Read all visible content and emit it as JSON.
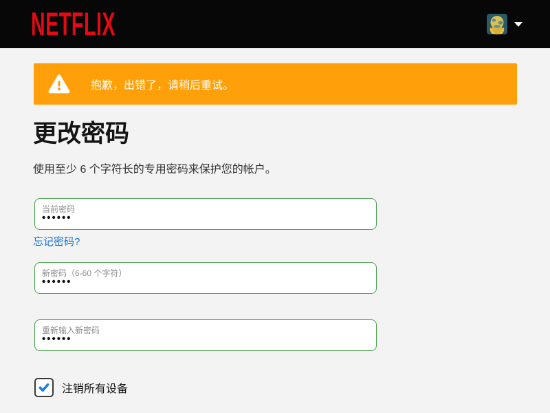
{
  "header": {
    "logo_text": "NETFLIX",
    "avatar_name": "profile-avatar",
    "caret_name": "caret-down"
  },
  "alert": {
    "message": "抱歉，出错了，请稍后重试。",
    "icon": "warning-triangle-icon"
  },
  "page": {
    "title": "更改密码",
    "subtitle": "使用至少 6 个字符长的专用密码来保护您的帐户。"
  },
  "form": {
    "current_password": {
      "label": "当前密码",
      "value_masked": "••••••"
    },
    "forgot_link_label": "忘记密码?",
    "new_password": {
      "label": "新密码（6-60 个字符）",
      "value_masked": "••••••"
    },
    "confirm_password": {
      "label": "重新输入新密码",
      "value_masked": "••••••"
    },
    "signout_checkbox": {
      "label": "注销所有设备",
      "checked": "true"
    }
  },
  "colors": {
    "netflix_red": "#e50914",
    "header_black": "#070707",
    "alert_orange": "#ffa00a",
    "page_background": "#f3f3f3",
    "input_border_green": "#46a046",
    "link_blue": "#1373d6",
    "check_blue": "#1d7fe0"
  }
}
